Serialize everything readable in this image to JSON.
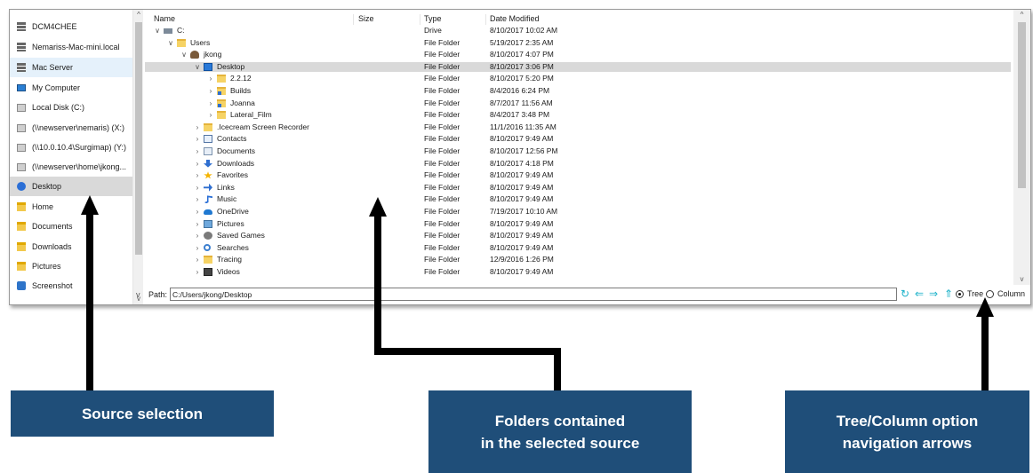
{
  "sidebar": {
    "items": [
      {
        "label": "DCM4CHEE",
        "icon": "server-icon"
      },
      {
        "label": "Nemariss-Mac-mini.local",
        "icon": "server-icon"
      },
      {
        "label": "Mac Server",
        "icon": "server-icon"
      },
      {
        "label": "My Computer",
        "icon": "computer-icon"
      },
      {
        "label": "Local Disk (C:)",
        "icon": "disk-icon"
      },
      {
        "label": "(\\\\newserver\\nemaris) (X:)",
        "icon": "network-drive-icon"
      },
      {
        "label": "(\\\\10.0.10.4\\Surgimap) (Y:)",
        "icon": "network-drive-icon"
      },
      {
        "label": "(\\\\newserver\\home\\jkong...",
        "icon": "network-drive-icon"
      },
      {
        "label": "Desktop",
        "icon": "desktop-icon"
      },
      {
        "label": "Home",
        "icon": "folder-icon"
      },
      {
        "label": "Documents",
        "icon": "folder-icon"
      },
      {
        "label": "Downloads",
        "icon": "folder-icon"
      },
      {
        "label": "Pictures",
        "icon": "folder-icon"
      },
      {
        "label": "Screenshot",
        "icon": "camera-icon"
      }
    ],
    "hovered_index": 2,
    "selected_index": 8
  },
  "columns": {
    "name": "Name",
    "size": "Size",
    "type": "Type",
    "date": "Date Modified"
  },
  "rows": [
    {
      "name": "C:",
      "size": "",
      "type": "Drive",
      "date": "8/10/2017 10:02 AM",
      "icon": "drive-icon",
      "expander": "expanded"
    },
    {
      "name": "Users",
      "size": "",
      "type": "File Folder",
      "date": "5/19/2017 2:35 AM",
      "icon": "folder-icon",
      "expander": "expanded"
    },
    {
      "name": "jkong",
      "size": "",
      "type": "File Folder",
      "date": "8/10/2017 4:07 PM",
      "icon": "user-icon",
      "expander": "expanded"
    },
    {
      "name": "Desktop",
      "size": "",
      "type": "File Folder",
      "date": "8/10/2017 3:06 PM",
      "icon": "desktop-icon",
      "expander": "expanded",
      "selected": true
    },
    {
      "name": "2.2.12",
      "size": "",
      "type": "File Folder",
      "date": "8/10/2017 5:20 PM",
      "icon": "folder-icon",
      "expander": "collapsed"
    },
    {
      "name": "Builds",
      "size": "",
      "type": "File Folder",
      "date": "8/4/2016 6:24 PM",
      "icon": "builds-icon",
      "expander": "collapsed"
    },
    {
      "name": "Joanna",
      "size": "",
      "type": "File Folder",
      "date": "8/7/2017 11:56 AM",
      "icon": "builds-icon",
      "expander": "collapsed"
    },
    {
      "name": "Lateral_Film",
      "size": "",
      "type": "File Folder",
      "date": "8/4/2017 3:48 PM",
      "icon": "folder-icon",
      "expander": "collapsed"
    },
    {
      "name": ".Icecream Screen Recorder",
      "size": "",
      "type": "File Folder",
      "date": "11/1/2016 11:35 AM",
      "icon": "folder-icon",
      "expander": "collapsed"
    },
    {
      "name": "Contacts",
      "size": "",
      "type": "File Folder",
      "date": "8/10/2017 9:49 AM",
      "icon": "contacts-icon",
      "expander": "collapsed"
    },
    {
      "name": "Documents",
      "size": "",
      "type": "File Folder",
      "date": "8/10/2017 12:56 PM",
      "icon": "documents-icon",
      "expander": "collapsed"
    },
    {
      "name": "Downloads",
      "size": "",
      "type": "File Folder",
      "date": "8/10/2017 4:18 PM",
      "icon": "download-icon",
      "expander": "collapsed"
    },
    {
      "name": "Favorites",
      "size": "",
      "type": "File Folder",
      "date": "8/10/2017 9:49 AM",
      "icon": "star-icon",
      "expander": "collapsed"
    },
    {
      "name": "Links",
      "size": "",
      "type": "File Folder",
      "date": "8/10/2017 9:49 AM",
      "icon": "links-icon",
      "expander": "collapsed"
    },
    {
      "name": "Music",
      "size": "",
      "type": "File Folder",
      "date": "8/10/2017 9:49 AM",
      "icon": "music-icon",
      "expander": "collapsed"
    },
    {
      "name": "OneDrive",
      "size": "",
      "type": "File Folder",
      "date": "7/19/2017 10:10 AM",
      "icon": "cloud-icon",
      "expander": "collapsed"
    },
    {
      "name": "Pictures",
      "size": "",
      "type": "File Folder",
      "date": "8/10/2017 9:49 AM",
      "icon": "pictures-icon",
      "expander": "collapsed"
    },
    {
      "name": "Saved Games",
      "size": "",
      "type": "File Folder",
      "date": "8/10/2017 9:49 AM",
      "icon": "games-icon",
      "expander": "collapsed"
    },
    {
      "name": "Searches",
      "size": "",
      "type": "File Folder",
      "date": "8/10/2017 9:49 AM",
      "icon": "search-icon",
      "expander": "collapsed"
    },
    {
      "name": "Tracing",
      "size": "",
      "type": "File Folder",
      "date": "12/9/2016 1:26 PM",
      "icon": "folder-icon",
      "expander": "collapsed"
    },
    {
      "name": "Videos",
      "size": "",
      "type": "File Folder",
      "date": "8/10/2017 9:49 AM",
      "icon": "video-icon",
      "expander": "collapsed"
    }
  ],
  "pathbar": {
    "label": "Path:",
    "value": "C:/Users/jkong/Desktop",
    "view_options": [
      {
        "label": "Tree",
        "checked": true
      },
      {
        "label": "Column",
        "checked": false
      }
    ]
  },
  "callouts": {
    "source": "Source selection",
    "folders_line1": "Folders contained",
    "folders_line2": "in the selected source",
    "tree_line1": "Tree/Column option",
    "tree_line2": "navigation arrows"
  },
  "colors": {
    "callout_bg": "#1f4e79",
    "selection": "#d9d9d9",
    "hover": "#e5f1fb",
    "nav_arrow": "#17b0c8"
  }
}
